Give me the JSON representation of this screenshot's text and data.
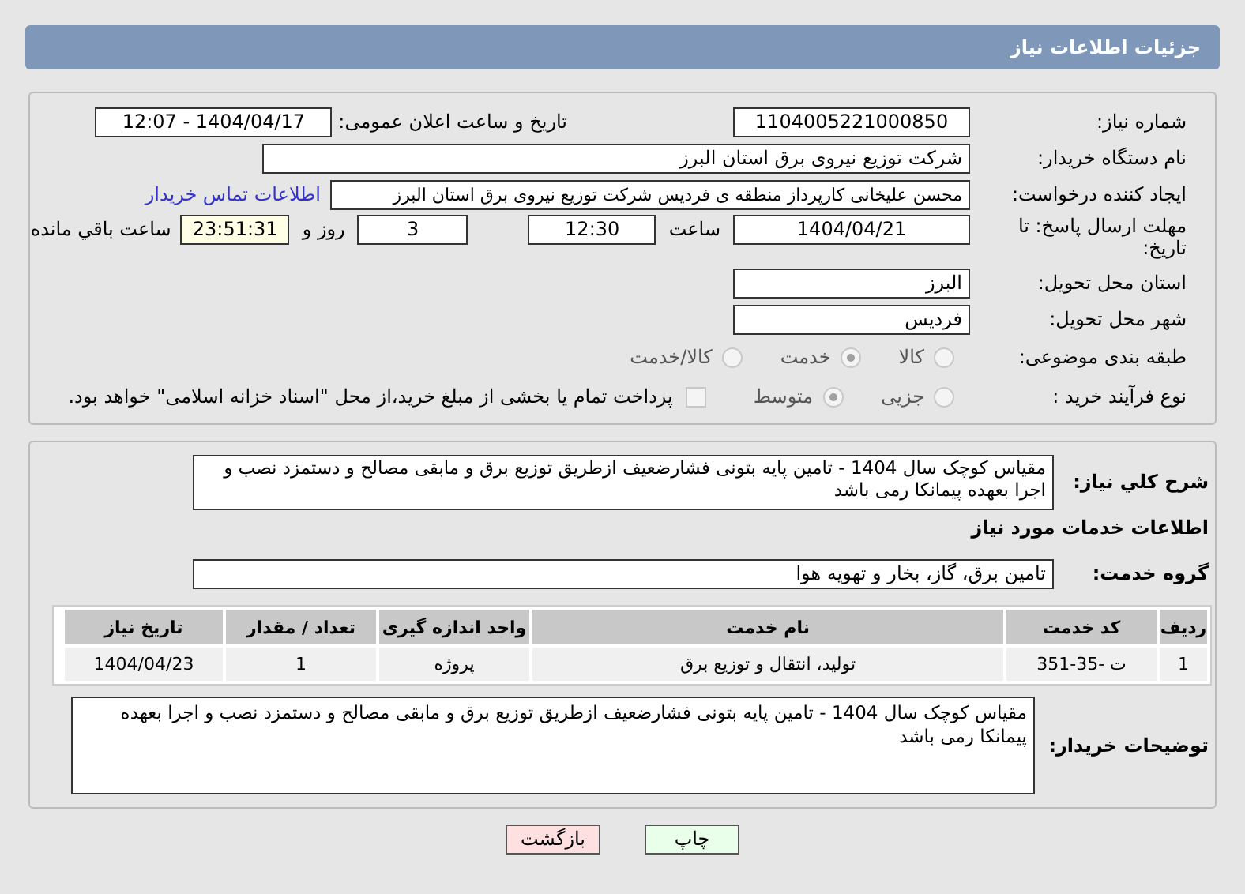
{
  "header": {
    "title": "جزئیات اطلاعات نیاز"
  },
  "need_number": {
    "label": "شماره نیاز:",
    "value": "1104005221000850"
  },
  "announce": {
    "label": "تاریخ و ساعت اعلان عمومی:",
    "value": "1404/04/17 - 12:07"
  },
  "buyer_org": {
    "label": "نام دستگاه خریدار:",
    "value": "شرکت توزیع نیروی برق استان البرز"
  },
  "creator": {
    "label": "ایجاد کننده درخواست:",
    "value": "محسن علیخانی کارپرداز منطقه ی فردیس شرکت توزیع نیروی برق استان البرز",
    "link": "اطلاعات تماس خریدار"
  },
  "deadline": {
    "label": "مهلت ارسال پاسخ: تا تاریخ:",
    "date": "1404/04/21",
    "time_label": "ساعت",
    "time": "12:30",
    "days": "3",
    "days_label": "روز و",
    "remaining": "23:51:31",
    "remaining_label": "ساعت باقي مانده"
  },
  "province": {
    "label": "استان محل تحویل:",
    "value": "البرز"
  },
  "city": {
    "label": "شهر محل تحویل:",
    "value": "فردیس"
  },
  "category": {
    "label": "طبقه بندی موضوعی:",
    "options": [
      {
        "label": "کالا",
        "selected": false
      },
      {
        "label": "خدمت",
        "selected": true
      },
      {
        "label": "کالا/خدمت",
        "selected": false
      }
    ]
  },
  "process": {
    "label": "نوع فرآیند خرید :",
    "options": [
      {
        "label": "جزیی",
        "selected": false
      },
      {
        "label": "متوسط",
        "selected": true
      }
    ],
    "payment_checkbox": {
      "checked": false,
      "label": "پرداخت تمام یا بخشی از مبلغ خرید،از محل \"اسناد خزانه اسلامی\" خواهد بود."
    }
  },
  "description": {
    "label": "شرح کلي نیاز:",
    "value": "مقیاس کوچک سال 1404 - تامین پایه بتونی فشارضعیف ازطریق توزیع برق و مابقی مصالح و دستمزد نصب و اجرا بعهده پیمانکا رمی باشد"
  },
  "services_title": "اطلاعات خدمات مورد نیاز",
  "service_group": {
    "label": "گروه خدمت:",
    "value": "تامین برق، گاز، بخار و تهویه هوا"
  },
  "table": {
    "columns": [
      "ردیف",
      "کد خدمت",
      "نام خدمت",
      "واحد اندازه گیری",
      "تعداد / مقدار",
      "تاریخ نیاز"
    ],
    "rows": [
      [
        "1",
        "ت -35-351",
        "تولید، انتقال و توزیع برق",
        "پروژه",
        "1",
        "1404/04/23"
      ]
    ]
  },
  "buyer_notes": {
    "label": "توضیحات خریدار:",
    "value": "مقیاس کوچک سال 1404 - تامین پایه بتونی فشارضعیف ازطریق توزیع برق و مابقی مصالح و دستمزد نصب و اجرا بعهده پیمانکا رمی باشد"
  },
  "buttons": [
    {
      "label": "چاپ",
      "kind": "print"
    },
    {
      "label": "بازگشت",
      "kind": "back"
    }
  ]
}
